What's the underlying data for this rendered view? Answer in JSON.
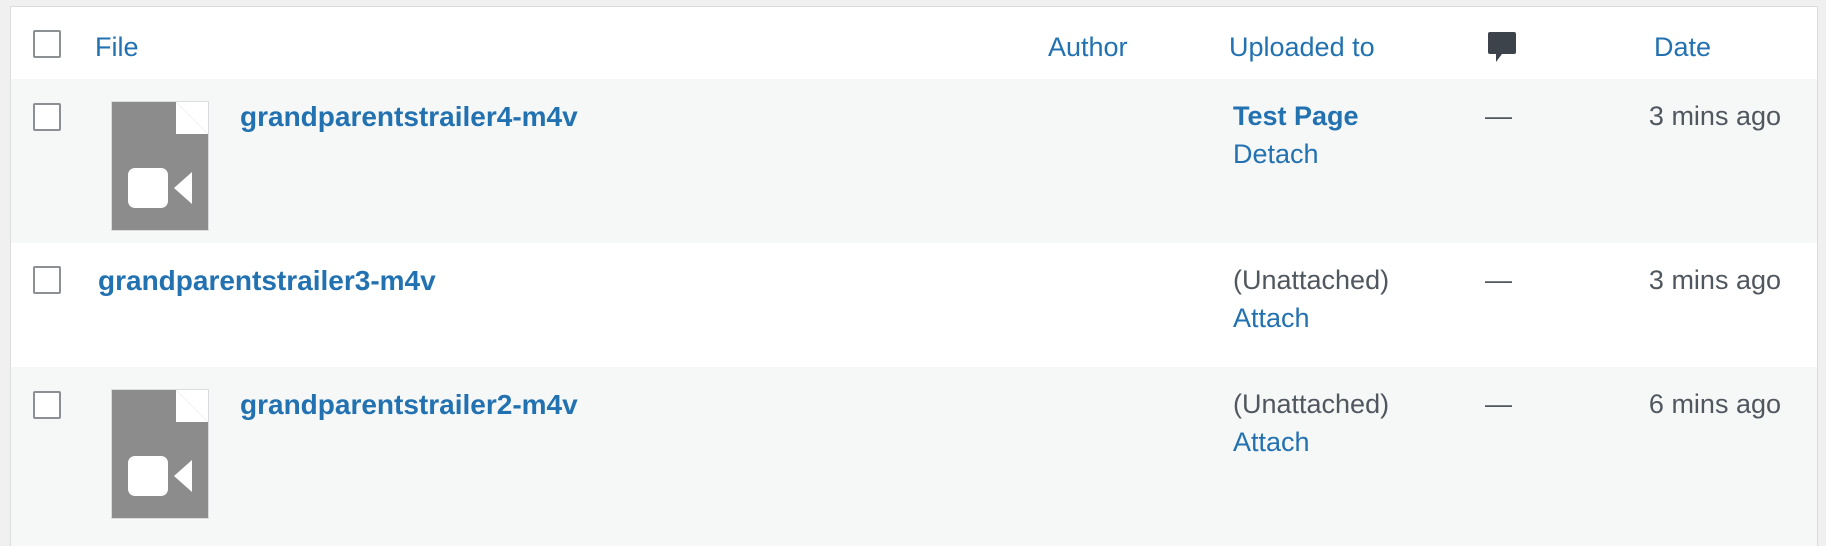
{
  "columns": {
    "file": "File",
    "author": "Author",
    "uploaded_to": "Uploaded to",
    "comments_icon": "comment-bubble-icon",
    "date": "Date"
  },
  "rows": [
    {
      "title": "grandparentstrailer4-m4v",
      "has_thumbnail": true,
      "thumbnail_icon": "video-file-icon",
      "uploaded_to": "Test Page",
      "action": "Detach",
      "comments": "—",
      "date": "3 mins ago"
    },
    {
      "title": "grandparentstrailer3-m4v",
      "has_thumbnail": false,
      "uploaded_to": "(Unattached)",
      "action": "Attach",
      "comments": "—",
      "date": "3 mins ago"
    },
    {
      "title": "grandparentstrailer2-m4v",
      "has_thumbnail": true,
      "thumbnail_icon": "video-file-icon",
      "uploaded_to": "(Unattached)",
      "action": "Attach",
      "comments": "—",
      "date": "6 mins ago"
    }
  ],
  "colors": {
    "link": "#2271b1",
    "text": "#50575e",
    "icon_gray": "#8c8c8c"
  }
}
